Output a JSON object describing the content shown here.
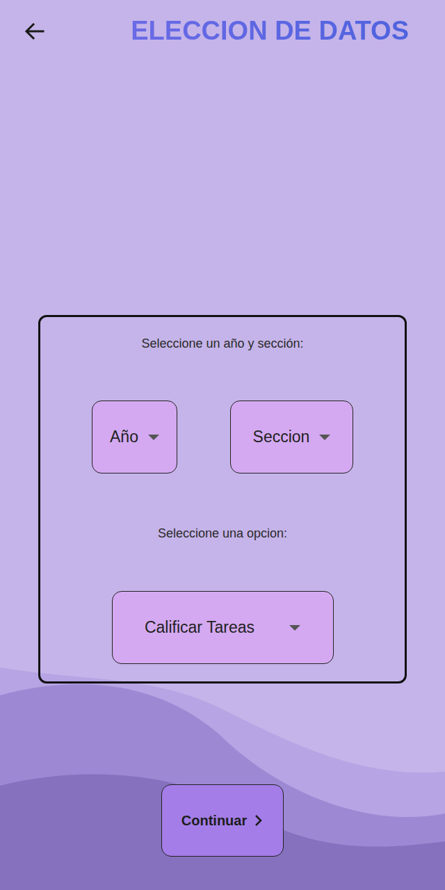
{
  "header": {
    "title": "ELECCION DE DATOS"
  },
  "panel": {
    "prompt_year_section": "Seleccione un año y sección:",
    "dropdowns": [
      {
        "label": "Año"
      },
      {
        "label": "Seccion"
      }
    ],
    "prompt_option": "Seleccione una opcion:",
    "option_dropdown": {
      "label": "Calificar Tareas"
    }
  },
  "buttons": [
    {
      "label": "Continuar"
    }
  ]
}
